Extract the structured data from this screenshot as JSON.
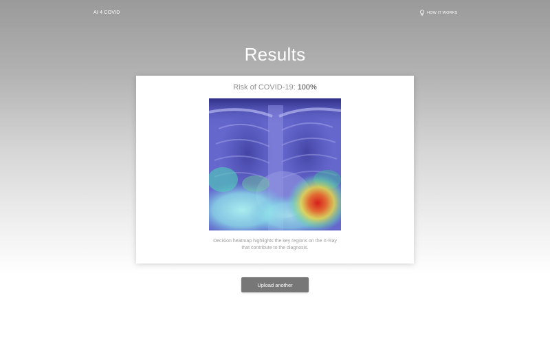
{
  "header": {
    "brand": "AI 4 COVID",
    "how_it_works_label": "HOW IT WORKS",
    "how_it_works_icon": "lightbulb-icon"
  },
  "main": {
    "title": "Results",
    "result_card": {
      "risk_label": "Risk of COVID-19:",
      "risk_value": "100%",
      "image_alt": "Chest X-Ray with decision heatmap",
      "caption_line1": "Decision heatmap highlights the key regions on the X-Ray",
      "caption_line2": "that contribute to the diagnosis."
    },
    "upload_button_label": "Upload another"
  },
  "colors": {
    "background_top": "#9a9a9a",
    "background_bottom": "#ffffff",
    "card": "#ffffff",
    "button": "#777777",
    "heatmap_base": "#5f61c8"
  }
}
